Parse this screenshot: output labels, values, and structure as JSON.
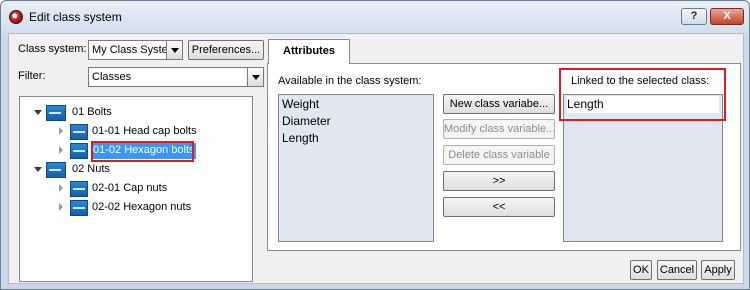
{
  "window": {
    "title": "Edit class system",
    "help_label": "?",
    "close_label": "X"
  },
  "class_system": {
    "label": "Class system:",
    "value": "My Class System",
    "preferences_label": "Preferences..."
  },
  "filter": {
    "label": "Filter:",
    "value": "Classes"
  },
  "tree": [
    {
      "label": "01 Bolts",
      "level": 0,
      "expanded": true,
      "selected": false
    },
    {
      "label": "01-01 Head cap bolts",
      "level": 1,
      "expanded": false,
      "selected": false
    },
    {
      "label": "01-02 Hexagon bolts",
      "level": 1,
      "expanded": false,
      "selected": true
    },
    {
      "label": "02 Nuts",
      "level": 0,
      "expanded": true,
      "selected": false
    },
    {
      "label": "02-01 Cap nuts",
      "level": 1,
      "expanded": false,
      "selected": false
    },
    {
      "label": "02-02 Hexagon nuts",
      "level": 1,
      "expanded": false,
      "selected": false
    }
  ],
  "tabs": {
    "attributes": "Attributes"
  },
  "available": {
    "label": "Available in the class system:",
    "items": [
      "Weight",
      "Diameter",
      "Length"
    ]
  },
  "linked": {
    "label": "Linked to the selected class:",
    "items": [
      "Length"
    ]
  },
  "actions": {
    "new_variable": "New class variabe...",
    "modify_variable": "Modify class variable...",
    "delete_variable": "Delete class variable",
    "add": ">>",
    "remove": "<<"
  },
  "footer": {
    "ok": "OK",
    "cancel": "Cancel",
    "apply": "Apply"
  },
  "colors": {
    "highlight_box": "#e01b1b",
    "selection": "#3399ff",
    "list_background": "#dfe7f1"
  }
}
